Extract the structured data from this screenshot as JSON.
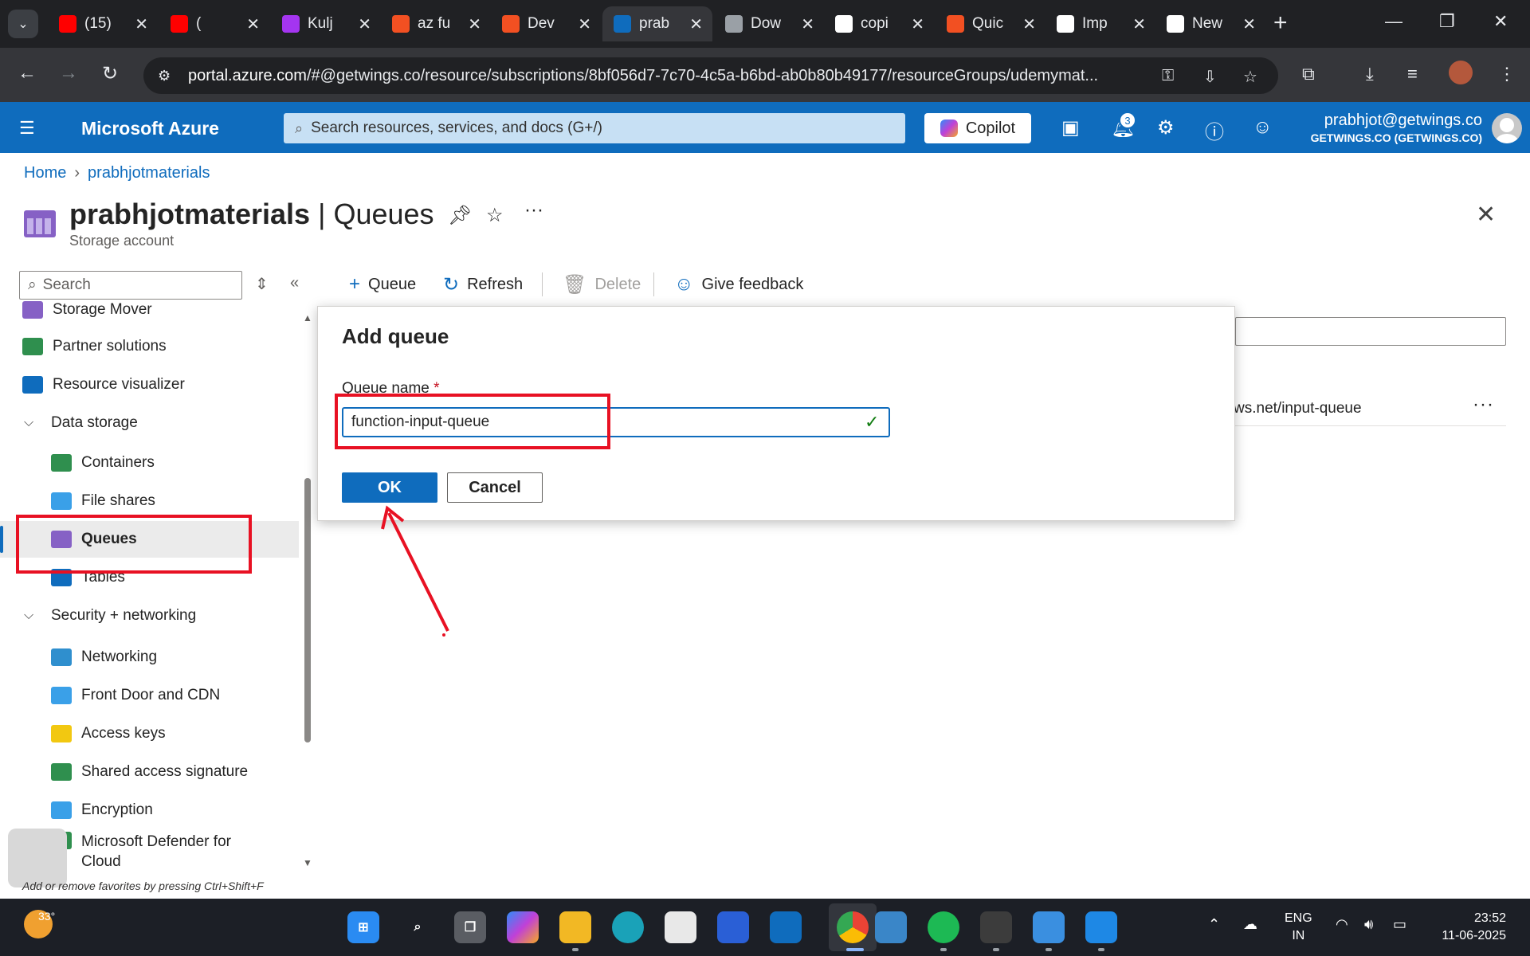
{
  "browser": {
    "tabs": [
      {
        "title": "(15)",
        "icon": "youtube-icon",
        "color": "#ff0000"
      },
      {
        "title": "(",
        "icon": "youtube-icon",
        "color": "#ff0000"
      },
      {
        "title": "Kulj",
        "icon": "udemy-icon",
        "color": "#a435f0"
      },
      {
        "title": "az fu",
        "icon": "microsoft-icon",
        "color": "#f25022"
      },
      {
        "title": "Dev",
        "icon": "microsoft-icon",
        "color": "#f25022"
      },
      {
        "title": "prab",
        "icon": "azure-icon",
        "color": "#0f6cbd"
      },
      {
        "title": "Dow",
        "icon": "globe-icon",
        "color": "#9aa0a6"
      },
      {
        "title": "copi",
        "icon": "github-icon",
        "color": "#ffffff"
      },
      {
        "title": "Quic",
        "icon": "microsoft-icon",
        "color": "#f25022"
      },
      {
        "title": "Imp",
        "icon": "openai-icon",
        "color": "#ffffff"
      },
      {
        "title": "New",
        "icon": "chrome-icon",
        "color": "#ffffff"
      }
    ],
    "url_host": "portal.azure.com",
    "url_path": "/#@getwings.co/resource/subscriptions/8bf056d7-7c70-4c5a-b6bd-ab0b80b49177/resourceGroups/udemymat..."
  },
  "azure": {
    "brand": "Microsoft Azure",
    "search_placeholder": "Search resources, services, and docs (G+/)",
    "copilot_label": "Copilot",
    "notification_count": "3",
    "user_email": "prabhjot@getwings.co",
    "user_org": "GETWINGS.CO (GETWINGS.CO)"
  },
  "breadcrumb": {
    "home": "Home",
    "resource": "prabhjotmaterials"
  },
  "page": {
    "resource_name": "prabhjotmaterials",
    "separator": " | ",
    "blade_name": "Queues",
    "subtitle": "Storage account",
    "more": "···"
  },
  "sidebar": {
    "search_placeholder": "Search",
    "items": [
      {
        "label": "Storage Mover",
        "kind": "l1",
        "icon_color": "#8661c5"
      },
      {
        "label": "Partner solutions",
        "kind": "l1",
        "icon_color": "#2f8f4e"
      },
      {
        "label": "Resource visualizer",
        "kind": "l1",
        "icon_color": "#0f6cbd"
      },
      {
        "label": "Data storage",
        "kind": "grp"
      },
      {
        "label": "Containers",
        "kind": "l2",
        "icon_color": "#2f8f4e"
      },
      {
        "label": "File shares",
        "kind": "l2",
        "icon_color": "#3aa0e8"
      },
      {
        "label": "Queues",
        "kind": "l2",
        "icon_color": "#8661c5",
        "selected": true
      },
      {
        "label": "Tables",
        "kind": "l2",
        "icon_color": "#0f6cbd"
      },
      {
        "label": "Security + networking",
        "kind": "grp"
      },
      {
        "label": "Networking",
        "kind": "l2",
        "icon_color": "#2f8fce"
      },
      {
        "label": "Front Door and CDN",
        "kind": "l2",
        "icon_color": "#3aa0e8"
      },
      {
        "label": "Access keys",
        "kind": "l2",
        "icon_color": "#f2c811"
      },
      {
        "label": "Shared access signature",
        "kind": "l2",
        "icon_color": "#2f8f4e"
      },
      {
        "label": "Encryption",
        "kind": "l2",
        "icon_color": "#3aa0e8"
      },
      {
        "label": "Microsoft Defender for",
        "label2": "Cloud",
        "kind": "l2",
        "icon_color": "#2f8f4e"
      }
    ],
    "fav_hint": "Add or remove favorites by pressing Ctrl+Shift+F"
  },
  "toolbar": {
    "add_queue": "Queue",
    "refresh": "Refresh",
    "delete": "Delete",
    "feedback": "Give feedback"
  },
  "list": {
    "row_url_fragment": "ws.net/input-queue",
    "row_more": "···"
  },
  "dialog": {
    "title": "Add queue",
    "field_label": "Queue name",
    "required_mark": "*",
    "field_value": "function-input-queue",
    "ok_label": "OK",
    "cancel_label": "Cancel"
  },
  "taskbar": {
    "temperature": "33°",
    "lang_line1": "ENG",
    "lang_line2": "IN",
    "time": "23:52",
    "date": "11-06-2025"
  },
  "colors": {
    "azure_blue": "#0f6cbd",
    "annotation_red": "#e81123"
  }
}
